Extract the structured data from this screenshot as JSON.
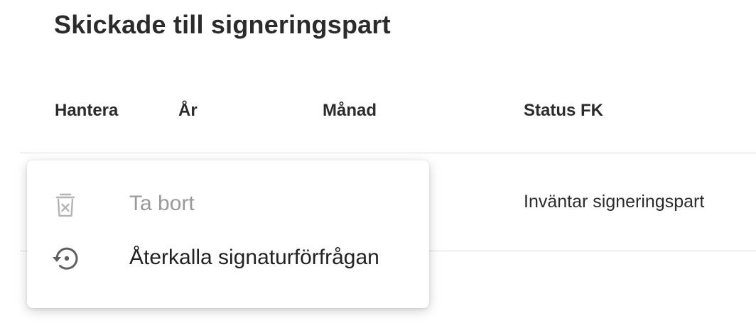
{
  "section": {
    "title": "Skickade till signeringspart"
  },
  "table": {
    "columns": [
      "Hantera",
      "År",
      "Månad",
      "Status FK"
    ],
    "rows": [
      {
        "status_fk": "Inväntar signeringspart"
      }
    ]
  },
  "context_menu": {
    "items": [
      {
        "label": "Ta bort",
        "icon": "trash-icon",
        "disabled": true
      },
      {
        "label": "Återkalla signaturförfrågan",
        "icon": "restore-history-icon",
        "disabled": false
      }
    ]
  },
  "colors": {
    "disabled_text": "#9a9a9a",
    "text": "#222222",
    "divider": "#dcdcdc"
  }
}
